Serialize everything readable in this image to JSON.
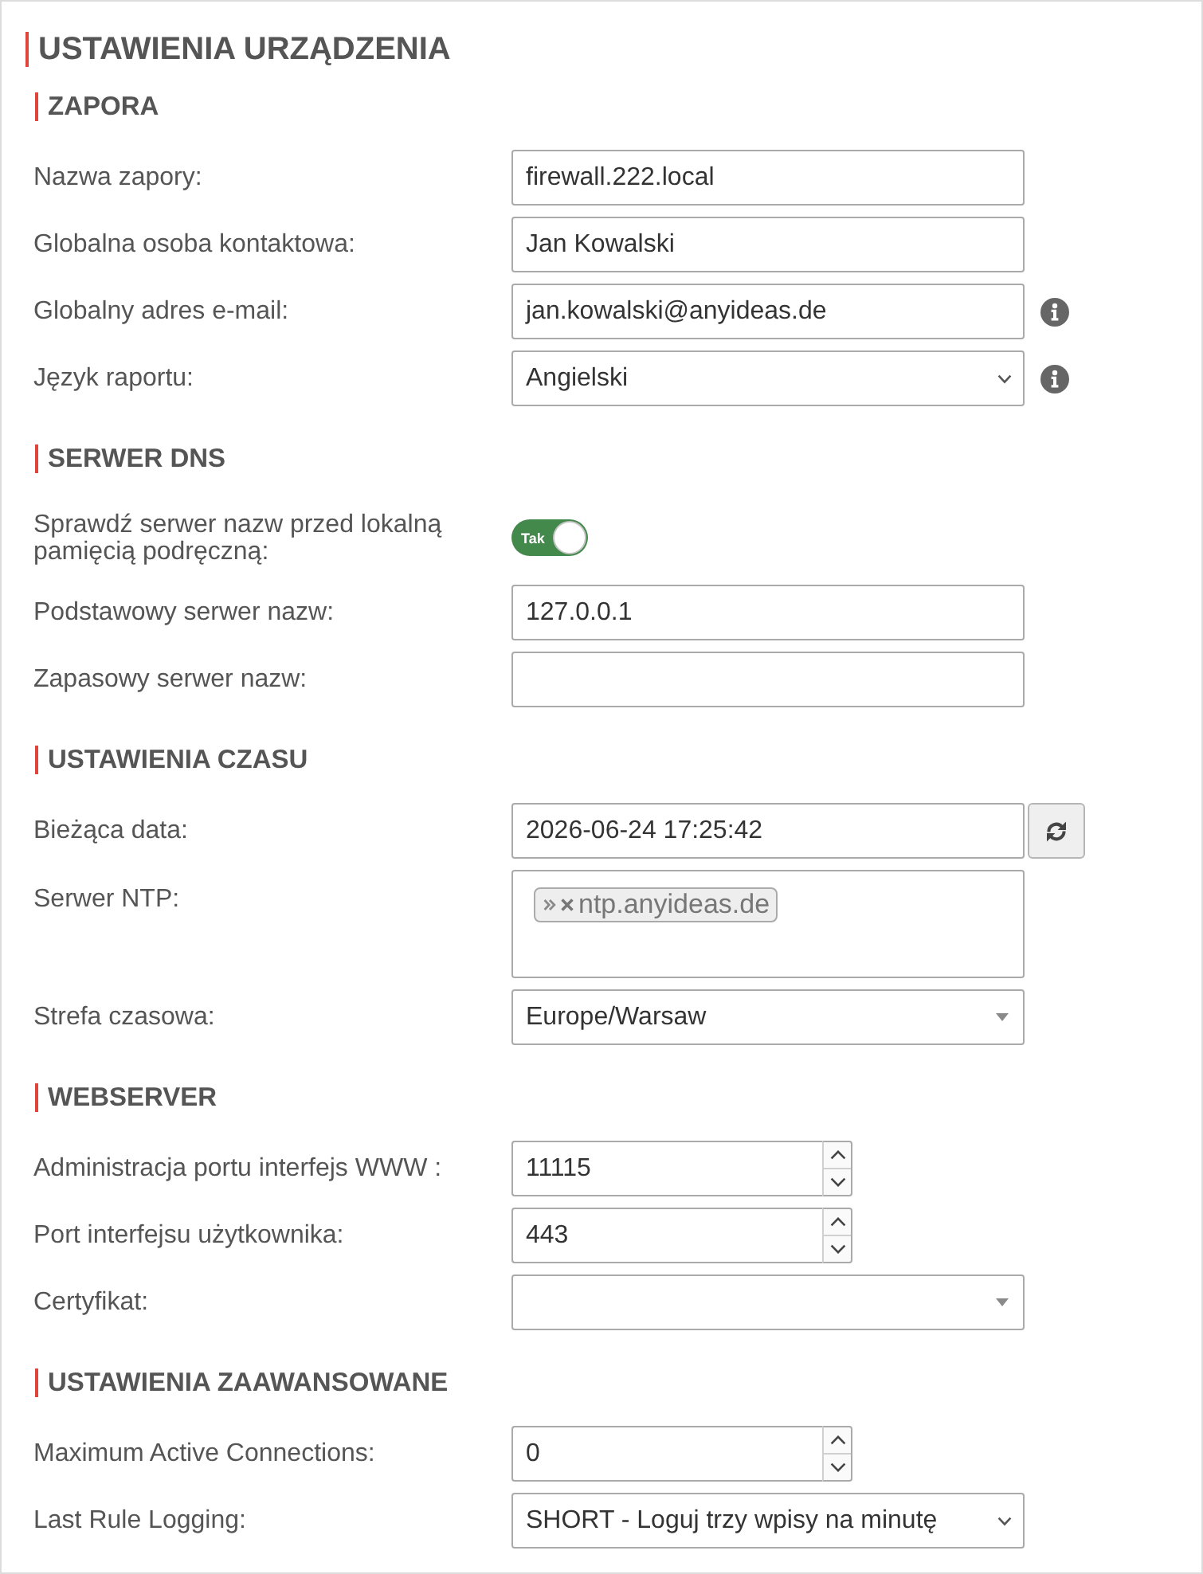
{
  "page": {
    "title": "USTAWIENIA URZĄDZENIA"
  },
  "sections": [
    {
      "title": "ZAPORA",
      "fields": [
        {
          "kind": "text",
          "label": "Nazwa zapory:",
          "value": "firewall.222.local"
        },
        {
          "kind": "text",
          "label": "Globalna osoba kontaktowa:",
          "value": "Jan Kowalski"
        },
        {
          "kind": "text",
          "label": "Globalny adres e-mail:",
          "value": "jan.kowalski@anyideas.de",
          "info": true
        },
        {
          "kind": "select",
          "label": "Język raportu:",
          "value": "Angielski",
          "info": true
        }
      ]
    },
    {
      "title": "SERWER DNS",
      "fields": [
        {
          "kind": "toggle",
          "label": "Sprawdź serwer nazw przed lokalną pamięcią podręczną:",
          "on": true,
          "text": "Tak"
        },
        {
          "kind": "text",
          "label": "Podstawowy serwer nazw:",
          "value": "127.0.0.1"
        },
        {
          "kind": "text",
          "label": "Zapasowy serwer nazw:"
        }
      ]
    },
    {
      "title": "USTAWIENIA CZASU",
      "fields": [
        {
          "kind": "datetime",
          "label": "Bieżąca data:",
          "value": "2026-06-24 17:25:42"
        },
        {
          "kind": "tags",
          "label": "Serwer NTP:",
          "tags": [
            "ntp.anyideas.de"
          ]
        },
        {
          "kind": "combobox",
          "label": "Strefa czasowa:",
          "value": "Europe/Warsaw"
        }
      ]
    },
    {
      "title": "WEBSERVER",
      "fields": [
        {
          "kind": "number",
          "label": "Administracja portu interfejs WWW :",
          "value": "11115"
        },
        {
          "kind": "number",
          "label": "Port interfejsu użytkownika:",
          "value": "443"
        },
        {
          "kind": "combobox",
          "label": "Certyfikat:"
        }
      ]
    },
    {
      "title": "USTAWIENIA ZAAWANSOWANE",
      "fields": [
        {
          "kind": "number",
          "label": "Maximum Active Connections:",
          "value": "0"
        },
        {
          "kind": "select",
          "label": "Last Rule Logging:",
          "value": "SHORT - Loguj trzy wpisy na minutę"
        }
      ]
    }
  ]
}
